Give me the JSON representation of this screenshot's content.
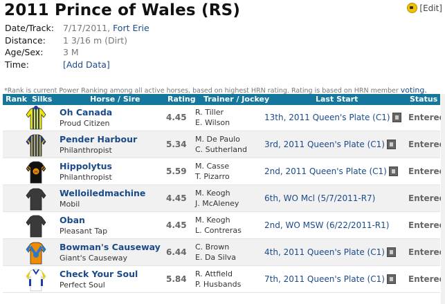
{
  "race": {
    "title": "2011 Prince of Wales (RS)",
    "edit_label": "[Edit]",
    "date_label": "Date/Track:",
    "date_value": "7/17/2011,",
    "track": "Fort Erie",
    "distance_label": "Distance:",
    "distance_value": "1 3/16 m (Dirt)",
    "age_label": "Age/Sex:",
    "age_value": "3 M",
    "time_label": "Time:",
    "time_link": "[Add Data]"
  },
  "note": {
    "text": "*Rank is current Power Ranking among all active horses, based on highest HRN rating. Rating is based on HRN member",
    "link": "voting."
  },
  "columns": {
    "rank": "Rank",
    "silks": "Silks",
    "horse": "Horse / Sire",
    "rating": "Rating",
    "trainer": "Trainer / Jockey",
    "last": "Last Start",
    "status": "Status"
  },
  "entries": [
    {
      "horse": "Oh Canada",
      "sire": "Proud Citizen",
      "rating": "4.45",
      "trainer": "R. Tiller",
      "jockey": "E. Wilson",
      "last": "13th, 2011 Queen's Plate (C1)",
      "film": true,
      "status": "Entered",
      "silk": "oh-canada"
    },
    {
      "horse": "Pender Harbour",
      "sire": "Philanthropist",
      "rating": "5.34",
      "trainer": "M. De Paulo",
      "jockey": "C. Sutherland",
      "last": "3rd, 2011 Queen's Plate (C1)",
      "film": true,
      "status": "Entered",
      "silk": "pender"
    },
    {
      "horse": "Hippolytus",
      "sire": "Philanthropist",
      "rating": "5.59",
      "trainer": "M. Casse",
      "jockey": "T. Pizarro",
      "last": "2nd, 2011 Queen's Plate (C1)",
      "film": true,
      "status": "Entered",
      "silk": "hippolytus"
    },
    {
      "horse": "Welloiledmachine",
      "sire": "Mobil",
      "rating": "4.45",
      "trainer": "M. Keogh",
      "jockey": "J. McAleney",
      "last": "6th, WO Mcl (5/7/2011-R7)",
      "film": false,
      "status": "Entered",
      "silk": "grey"
    },
    {
      "horse": "Oban",
      "sire": "Pleasant Tap",
      "rating": "4.45",
      "trainer": "M. Keogh",
      "jockey": "L. Contreras",
      "last": "2nd, WO MSW (6/22/2011-R1)",
      "film": false,
      "status": "Entered",
      "silk": "grey"
    },
    {
      "horse": "Bowman's Causeway",
      "sire": "Giant's Causeway",
      "rating": "6.44",
      "trainer": "C. Brown",
      "jockey": "E. Da Silva",
      "last": "4th, 2011 Queen's Plate (C1)",
      "film": true,
      "status": "Entered",
      "silk": "bowman"
    },
    {
      "horse": "Check Your Soul",
      "sire": "Perfect Soul",
      "rating": "5.84",
      "trainer": "R. Attfield",
      "jockey": "P. Husbands",
      "last": "7th, 2011 Queen's Plate (C1)",
      "film": true,
      "status": "Entered",
      "silk": "check"
    }
  ]
}
